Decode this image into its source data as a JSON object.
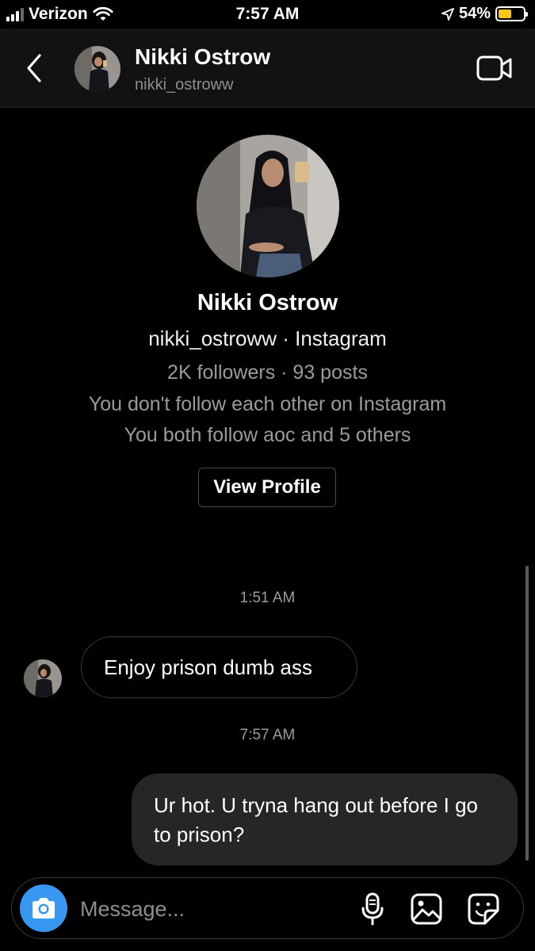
{
  "status_bar": {
    "carrier": "Verizon",
    "time": "7:57 AM",
    "battery_percent": "54%",
    "battery_level": 0.54,
    "battery_color": "#f5c518",
    "icons": [
      "signal-icon",
      "wifi-icon",
      "location-arrow-icon",
      "battery-icon"
    ]
  },
  "header": {
    "name": "Nikki Ostrow",
    "username": "nikki_ostroww",
    "icons": [
      "back-chevron-icon",
      "video-call-icon"
    ]
  },
  "profile": {
    "name": "Nikki Ostrow",
    "handle_line": "nikki_ostroww · Instagram",
    "stats_line": "2K followers · 93 posts",
    "follow_status": "You don't follow each other on Instagram",
    "mutual_line": "You both follow aoc and 5 others",
    "view_profile_label": "View Profile"
  },
  "thread": {
    "messages": [
      {
        "timestamp": "1:51 AM",
        "direction": "incoming",
        "text": "Enjoy prison dumb ass"
      },
      {
        "timestamp": "7:57 AM",
        "direction": "outgoing",
        "text": "Ur hot. U tryna hang out before I go to prison?"
      }
    ]
  },
  "composer": {
    "placeholder": "Message...",
    "accent_color": "#3897f0",
    "icons": [
      "camera-icon",
      "microphone-icon",
      "gallery-icon",
      "sticker-icon"
    ]
  }
}
